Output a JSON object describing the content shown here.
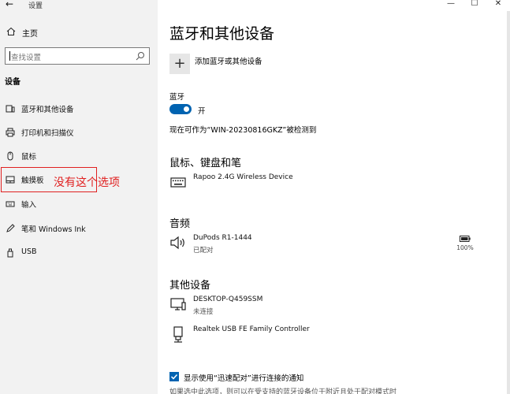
{
  "window": {
    "app_title": "设置",
    "controls": [
      "—",
      "☐",
      "✕"
    ]
  },
  "sidebar": {
    "home_label": "主页",
    "search_placeholder": "查找设置",
    "section_header": "设备",
    "items": [
      {
        "label": "蓝牙和其他设备",
        "icon": "bluetooth-devices-icon"
      },
      {
        "label": "打印机和扫描仪",
        "icon": "printer-icon"
      },
      {
        "label": "鼠标",
        "icon": "mouse-icon"
      },
      {
        "label": "触摸板",
        "icon": "touchpad-icon"
      },
      {
        "label": "输入",
        "icon": "keyboard-icon"
      },
      {
        "label": "笔和 Windows Ink",
        "icon": "pen-icon"
      },
      {
        "label": "USB",
        "icon": "usb-icon"
      }
    ],
    "annotation_text": "没有这个选项",
    "annotation_color": "#e02020"
  },
  "main": {
    "title": "蓝牙和其他设备",
    "add_device_label": "添加蓝牙或其他设备",
    "bluetooth_label": "蓝牙",
    "bluetooth_state": "开",
    "discoverable_text": "现在可作为“WIN-20230816GKZ”被检测到",
    "sections": {
      "mouse_keyboard_pen": {
        "title": "鼠标、键盘和笔",
        "devices": [
          {
            "name": "Rapoo 2.4G Wireless Device",
            "status": "",
            "icon": "keyboard-icon"
          }
        ]
      },
      "audio": {
        "title": "音频",
        "devices": [
          {
            "name": "DuPods R1-1444",
            "status": "已配对",
            "battery": "100%",
            "icon": "speaker-icon"
          }
        ]
      },
      "other": {
        "title": "其他设备",
        "devices": [
          {
            "name": "DESKTOP-Q459SSM",
            "status": "未连接",
            "icon": "monitor-icon"
          },
          {
            "name": "Realtek USB FE Family Controller",
            "status": "",
            "icon": "usb-device-icon"
          }
        ]
      }
    },
    "swift_pair_label": "显示使用“迅速配对”进行连接的通知",
    "swift_pair_checked": true,
    "hint_text": "如果选中此选项，则可以在受支持的蓝牙设备位于附近且处于配对模式时"
  },
  "colors": {
    "accent": "#0063b1",
    "sidebar_bg": "#f2f2f2"
  }
}
